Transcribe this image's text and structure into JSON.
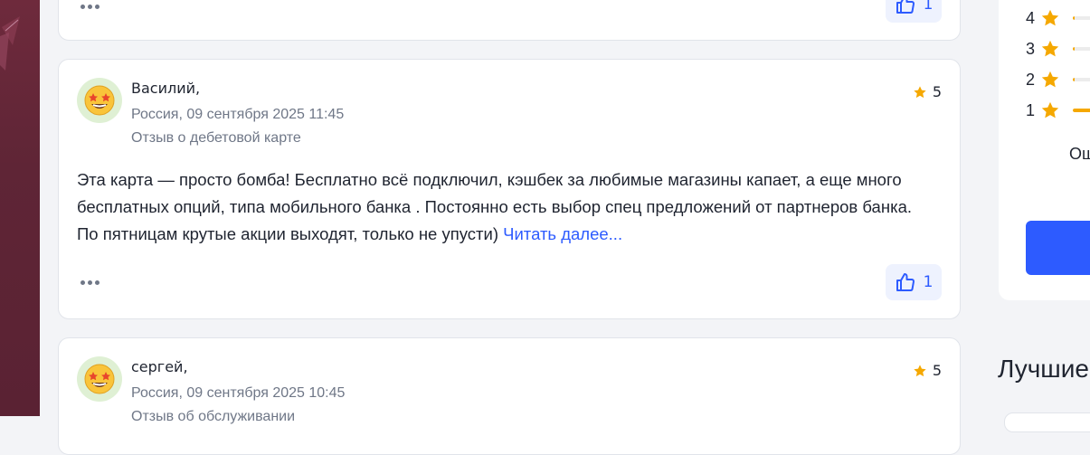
{
  "reviews": [
    {
      "author": "",
      "meta": "",
      "type": "",
      "rating": "",
      "text": "",
      "likes": "1"
    },
    {
      "author": "Василий,",
      "meta": "Россия, 09 сентября 2025 11:45",
      "type": "Отзыв о дебетовой карте",
      "rating": "5",
      "text": "Эта карта — просто бомба! Бесплатно всё подключил, кэшбек за любимые магазины капает, а еще много бесплатных опций, типа мобильного банка . Постоянно есть выбор спец предложений от партнеров банка. По пятницам крутые акции выходят, только не упусти)",
      "read_more": "Читать далее...",
      "likes": "1"
    },
    {
      "author": "сергей,",
      "meta": "Россия, 09 сентября 2025 10:45",
      "type": "Отзыв об обслуживании",
      "rating": "5"
    }
  ],
  "sidebar": {
    "distribution": [
      {
        "stars": "4",
        "fill": 0.05
      },
      {
        "stars": "3",
        "fill": 0.02
      },
      {
        "stars": "2",
        "fill": 0.04
      },
      {
        "stars": "1",
        "fill": 0.85
      }
    ],
    "text_fragment": "Ош",
    "heading_fragment": "Лучшие"
  },
  "colors": {
    "accent": "#2d5bff",
    "star": "#f5a800",
    "rail": "#6e2a3c"
  },
  "icons": {
    "more": "more-dots-icon",
    "like": "thumbs-up-icon",
    "star": "star-icon",
    "avatar": "star-struck-emoji-icon"
  }
}
